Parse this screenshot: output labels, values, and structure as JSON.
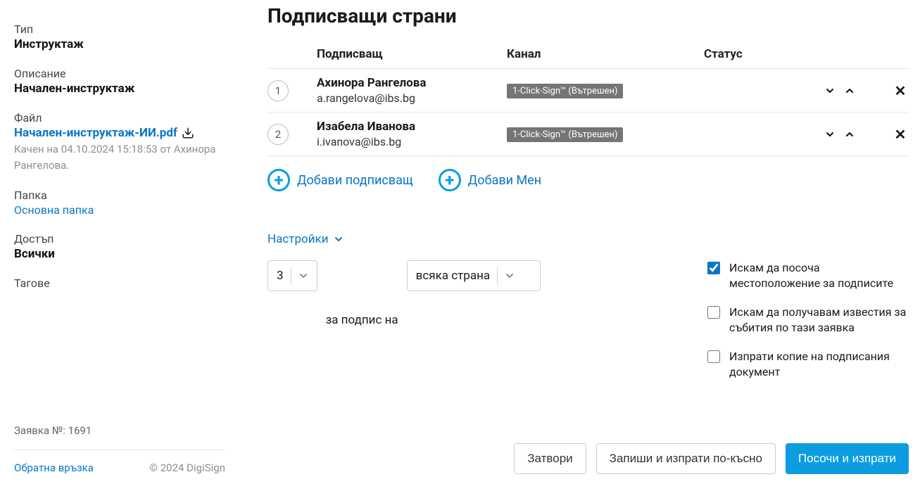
{
  "sidebar": {
    "type_label": "Тип",
    "type_value": "Инструктаж",
    "desc_label": "Описание",
    "desc_value": "Начален-инструктаж",
    "file_label": "Файл",
    "file_link": "Начален-инструктаж-ИИ.pdf",
    "file_meta": "Качен на 04.10.2024 15:18:53 от Ахинора Рангелова.",
    "folder_label": "Папка",
    "folder_value": "Основна папка",
    "access_label": "Достъп",
    "access_value": "Всички",
    "tags_label": "Тагове",
    "request_number": "Заявка №: 1691",
    "feedback_link": "Обратна връзка",
    "copyright": "© 2024 DigiSign"
  },
  "main": {
    "title": "Подписващи страни",
    "columns": {
      "signer": "Подписващ",
      "channel": "Канал",
      "status": "Статус"
    },
    "signers": [
      {
        "num": "1",
        "name": "Ахинора Рангелова",
        "email": "a.rangelova@ibs.bg",
        "channel": "1-Click-Sign™ (Вътрешен)"
      },
      {
        "num": "2",
        "name": "Изабела Иванова",
        "email": "i.ivanova@ibs.bg",
        "channel": "1-Click-Sign™ (Вътрешен)"
      }
    ],
    "add_signer": "Добави подписващ",
    "add_me": "Добави Мен",
    "settings_toggle": "Настройки",
    "count_select": "3",
    "count_label": "за подпис на",
    "page_select": "всяка страна",
    "checks": {
      "c1": "Искам да посоча местоположение за подписите",
      "c2": "Искам да получавам известия за събития по тази заявка",
      "c3": "Изпрати копие на подписания документ"
    },
    "buttons": {
      "close": "Затвори",
      "save_send_later": "Запиши и изпрати по-късно",
      "point_and_send": "Посочи и изпрати"
    }
  }
}
